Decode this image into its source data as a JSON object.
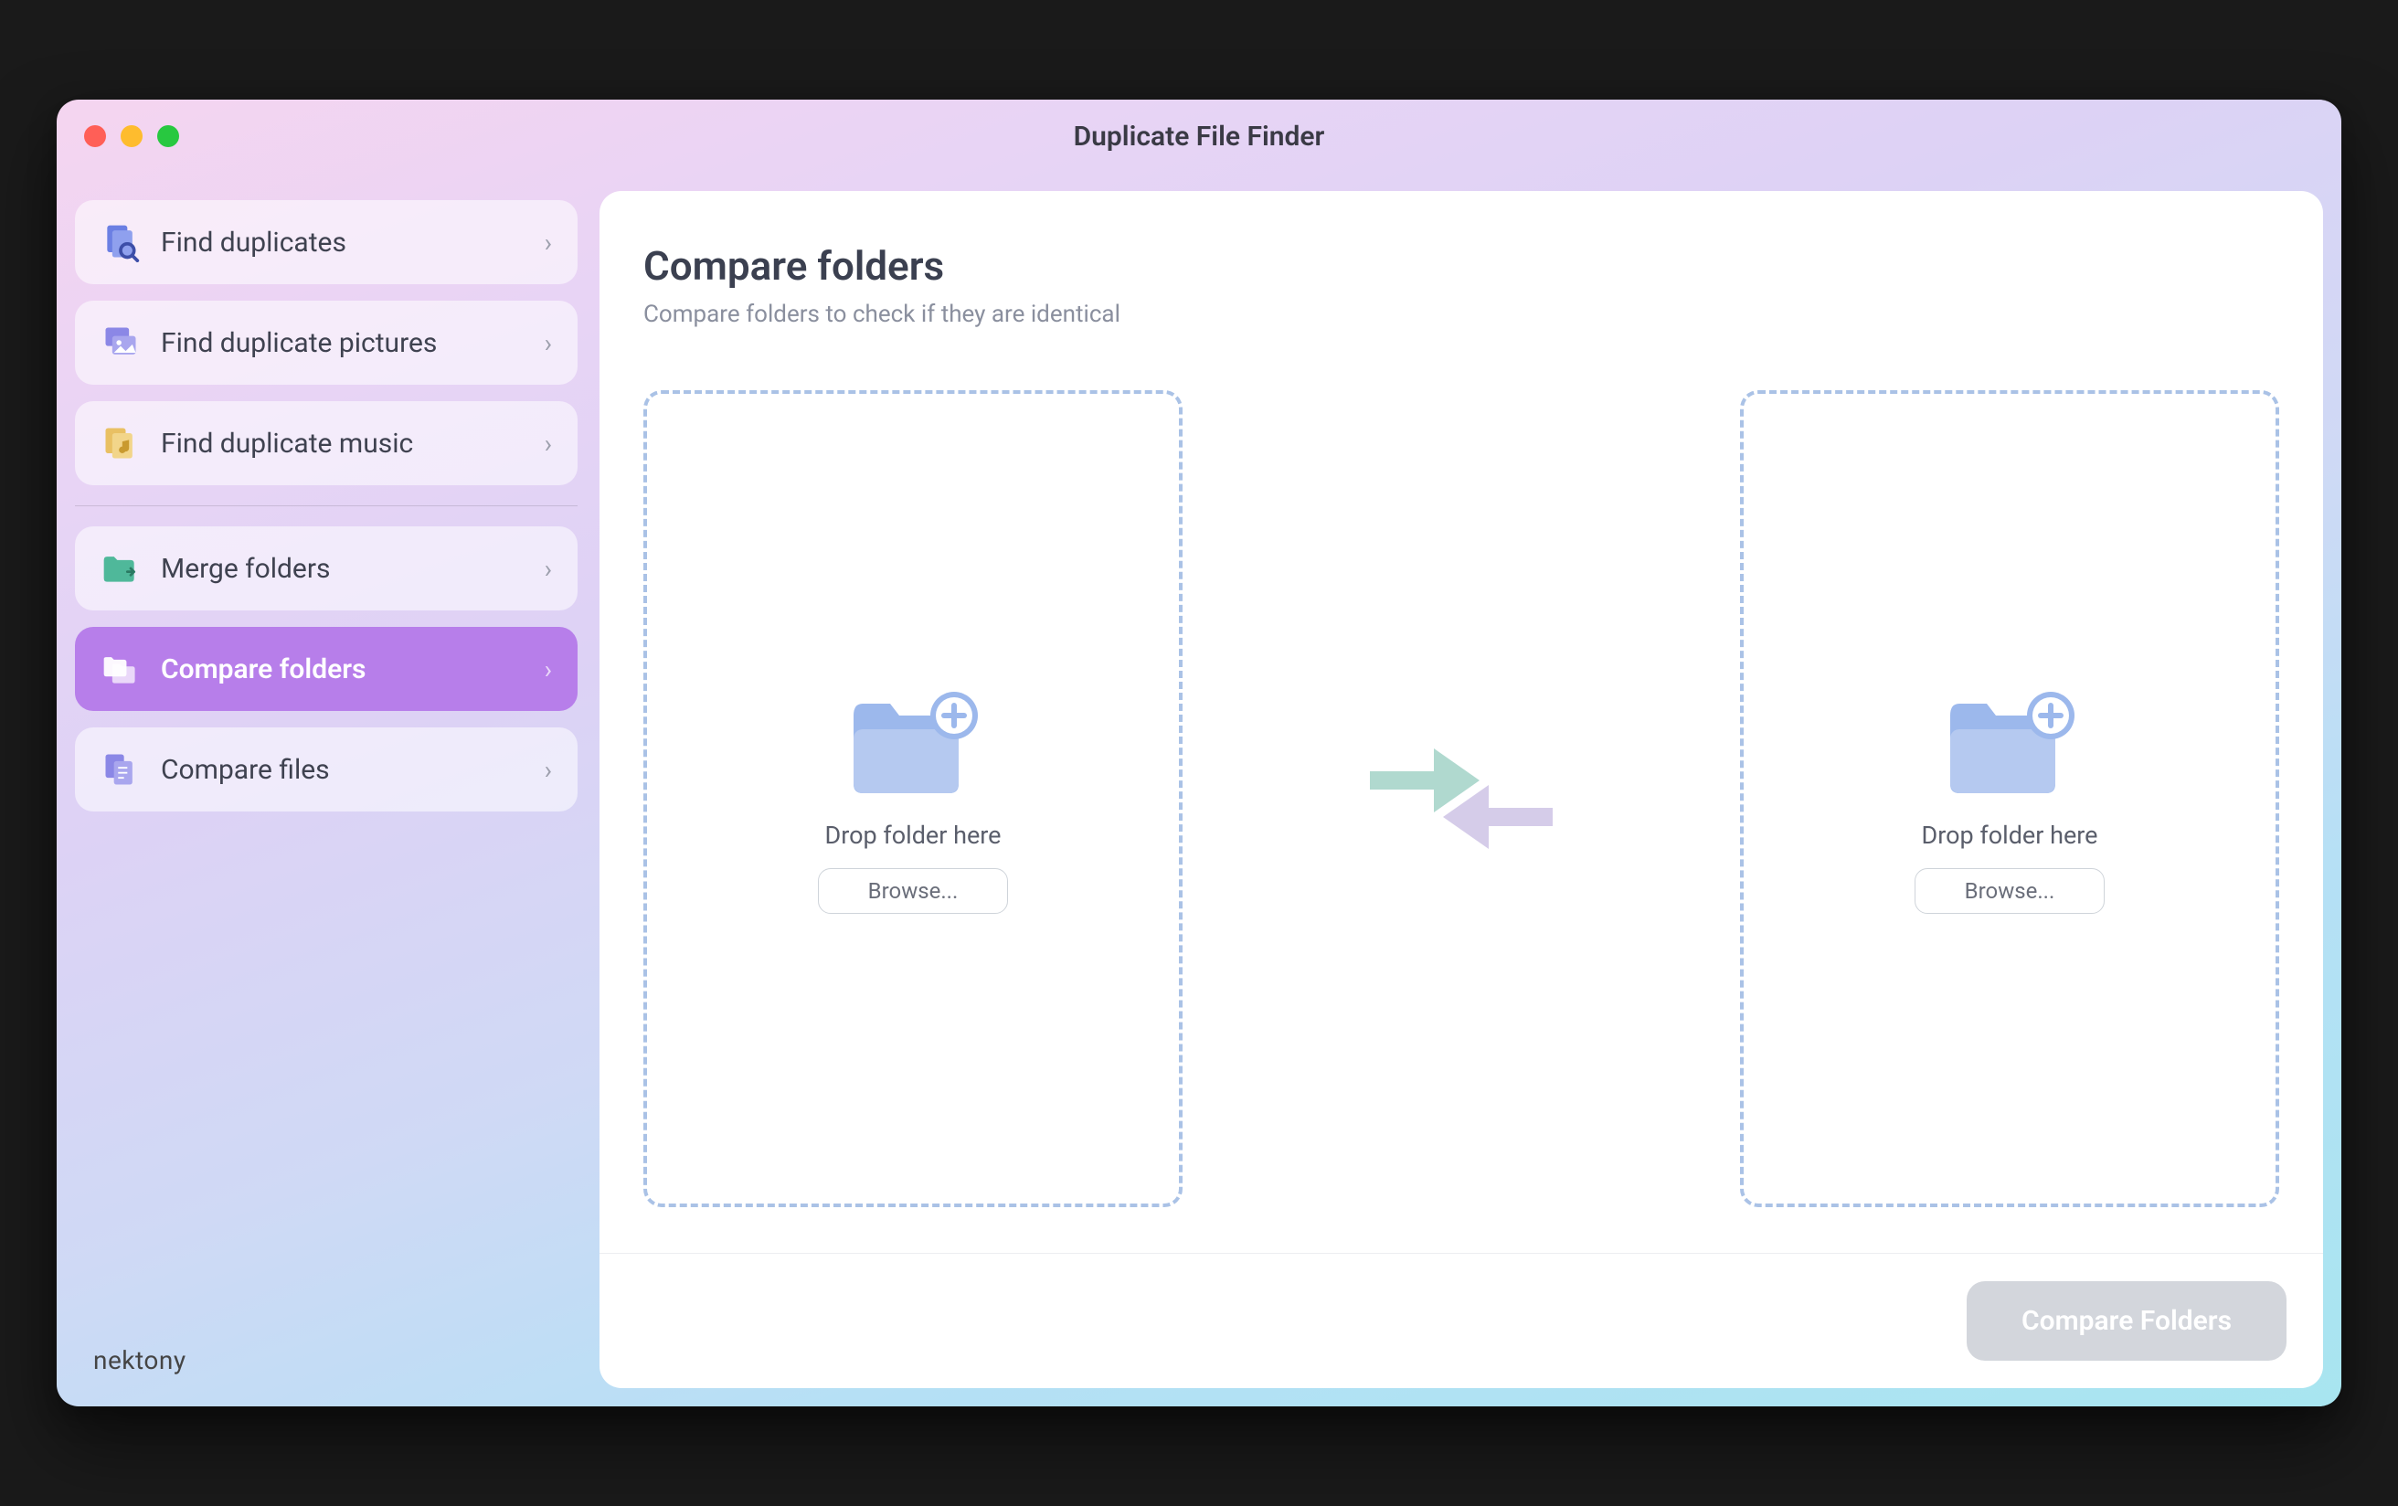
{
  "window": {
    "title": "Duplicate File Finder"
  },
  "sidebar": {
    "items": [
      {
        "label": "Find duplicates",
        "icon": "file-search",
        "color": "#6b7fe3"
      },
      {
        "label": "Find duplicate pictures",
        "icon": "pictures",
        "color": "#8b87e6"
      },
      {
        "label": "Find duplicate music",
        "icon": "music",
        "color": "#e9c063"
      },
      {
        "label": "Merge folders",
        "icon": "folder-merge",
        "color": "#4fb89a"
      },
      {
        "label": "Compare folders",
        "icon": "folder-compare",
        "color": "#ffffff",
        "active": true
      },
      {
        "label": "Compare files",
        "icon": "file-compare",
        "color": "#8b87e6"
      }
    ]
  },
  "main": {
    "title": "Compare folders",
    "subtitle": "Compare folders to check if they are identical",
    "dropzones": [
      {
        "label": "Drop folder here",
        "browse": "Browse..."
      },
      {
        "label": "Drop folder here",
        "browse": "Browse..."
      }
    ],
    "action_button": "Compare Folders"
  },
  "brand": "nektony"
}
